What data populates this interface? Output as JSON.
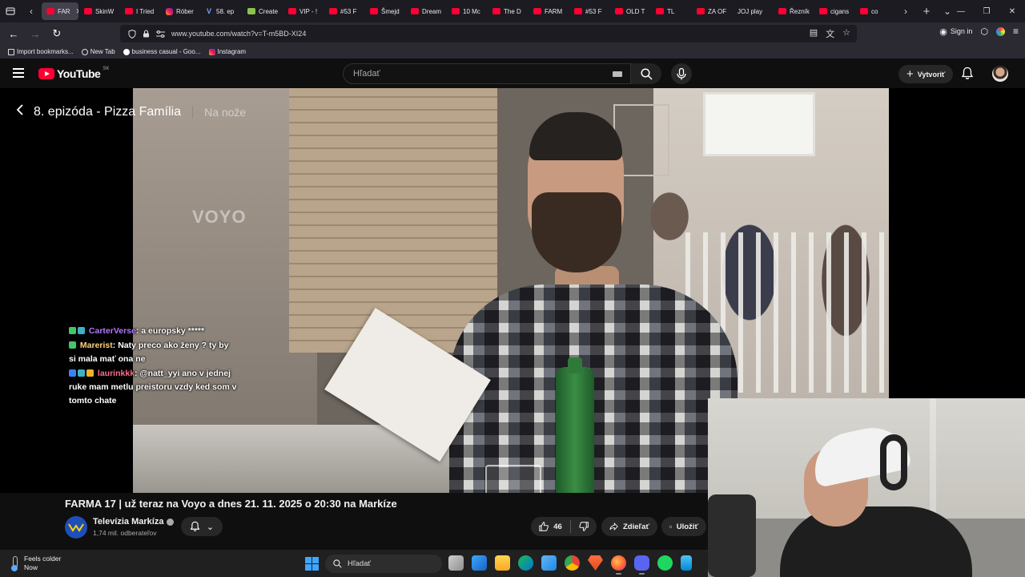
{
  "browser": {
    "tabs": [
      {
        "label": "FAR",
        "icon": "yt",
        "active": true
      },
      {
        "label": "SkinW",
        "icon": "yt"
      },
      {
        "label": "I Tried",
        "icon": "yt"
      },
      {
        "label": "Róber",
        "icon": "ig"
      },
      {
        "label": "58. ep",
        "icon": "v"
      },
      {
        "label": "Create",
        "icon": "cr"
      },
      {
        "label": "VIP - !",
        "icon": "yt"
      },
      {
        "label": "#53 F",
        "icon": "yt"
      },
      {
        "label": "Šmejd",
        "icon": "yt"
      },
      {
        "label": "Dream",
        "icon": "yt"
      },
      {
        "label": "10 Mc",
        "icon": "yt"
      },
      {
        "label": "The D",
        "icon": "yt"
      },
      {
        "label": "FARM",
        "icon": "yt"
      },
      {
        "label": "#53 F",
        "icon": "yt"
      },
      {
        "label": "OLD T",
        "icon": "yt"
      },
      {
        "label": "TL",
        "icon": "yt"
      },
      {
        "label": "ZA OF",
        "icon": "yt"
      },
      {
        "label": "JOJ play",
        "icon": "none"
      },
      {
        "label": "Řezník",
        "icon": "yt"
      },
      {
        "label": "cigans",
        "icon": "yt"
      },
      {
        "label": "co",
        "icon": "yt"
      }
    ],
    "url": "www.youtube.com/watch?v=T-m5BD-XI24",
    "sign_in": "Sign in",
    "bookmarks": [
      {
        "label": "Import bookmarks...",
        "icon": "import"
      },
      {
        "label": "New Tab",
        "icon": "globe"
      },
      {
        "label": "business casual - Goo...",
        "icon": "google"
      },
      {
        "label": "Instagram",
        "icon": "instagram"
      }
    ]
  },
  "youtube": {
    "logo_text": "YouTube",
    "country": "SK",
    "search_placeholder": "Hľadať",
    "create_label": "Vytvoriť"
  },
  "player": {
    "episode_title": "8. epizóda - Pizza Família",
    "episode_sub": "Na nože",
    "watermark": "VOYO"
  },
  "chat": [
    {
      "user": "CarterVerse",
      "text": ": a europsky *****",
      "badges": [
        "green",
        "teal"
      ]
    },
    {
      "user": "Marerist",
      "text": ": Naty preco ako ženy ? ty by si mala mať ona ne",
      "badges": [
        "green"
      ]
    },
    {
      "user": "laurinkkk",
      "text": ": @natt_yyi ano v jednej ruke mam metlu preistoru vzdy ked som v tomto chate",
      "badges": [
        "blue",
        "teal",
        "gold"
      ]
    }
  ],
  "video": {
    "title": "FARMA 17 | už teraz na Voyo a dnes 21. 11. 2025 o 20:30 na Markíze",
    "channel": "Televízia Markíza",
    "subscribers": "1,74 mil. odberateľov",
    "likes": "46",
    "share_label": "Zdieľať",
    "save_label": "Uložiť"
  },
  "taskbar": {
    "weather_title": "Feels colder",
    "weather_sub": "Now",
    "search_placeholder": "Hľadať"
  },
  "colors": {
    "youtube_red": "#ff0033",
    "page_bg": "#0f0f0f",
    "accent_blue": "#3ea6ff"
  }
}
